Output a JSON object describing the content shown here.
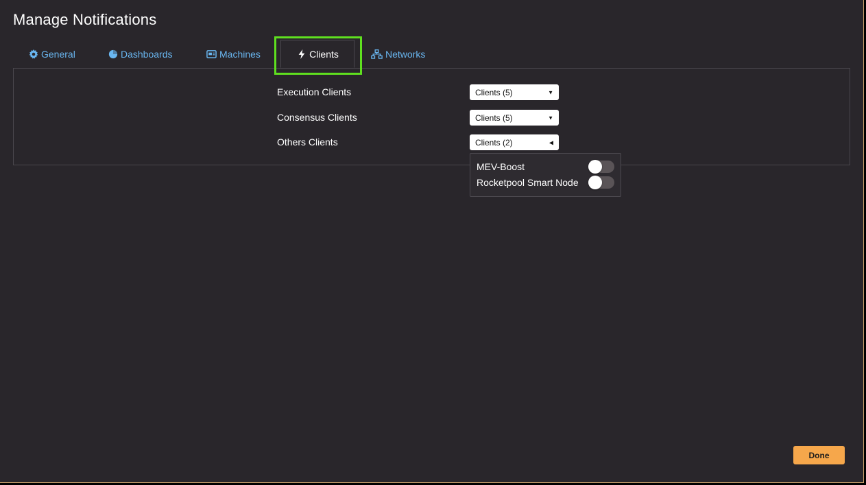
{
  "dialog": {
    "title": "Manage Notifications"
  },
  "tabs": [
    {
      "label": "General",
      "icon": "gear-icon"
    },
    {
      "label": "Dashboards",
      "icon": "pie-chart-icon"
    },
    {
      "label": "Machines",
      "icon": "monitor-icon"
    },
    {
      "label": "Clients",
      "icon": "lightning-bolt-icon",
      "active": true
    },
    {
      "label": "Networks",
      "icon": "network-icon"
    }
  ],
  "clients": {
    "rows": [
      {
        "label": "Execution Clients",
        "select_value": "Clients (5)",
        "state": "collapsed"
      },
      {
        "label": "Consensus Clients",
        "select_value": "Clients (5)",
        "state": "collapsed"
      },
      {
        "label": "Others Clients",
        "select_value": "Clients (2)",
        "state": "expanded"
      }
    ],
    "dropdown_items": [
      {
        "label": "MEV-Boost",
        "enabled": false
      },
      {
        "label": "Rocketpool Smart Node",
        "enabled": false
      }
    ]
  },
  "footer": {
    "done_label": "Done"
  },
  "colors": {
    "background": "#29262b",
    "tab_link": "#69b6f0",
    "highlight": "#5fe01f",
    "done_button": "#f6a74b",
    "toggle_off": "#5a5457"
  }
}
